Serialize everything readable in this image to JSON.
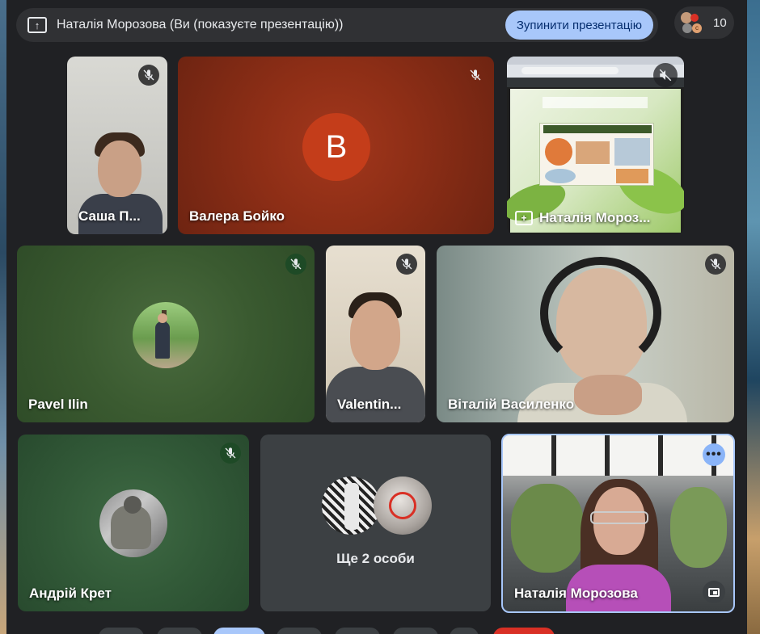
{
  "top_bar": {
    "presenting_text": "Наталія Морозова (Ви (показуєте презентацію))",
    "stop_button_label": "Зупинити презентацію",
    "participant_count": "10"
  },
  "avatar_initial": "B",
  "tiles": [
    {
      "name": "Саша П..."
    },
    {
      "name": "Валера Бойко"
    },
    {
      "name": "Наталія Мороз..."
    },
    {
      "name": "Pavel Ilin"
    },
    {
      "name": "Valentin..."
    },
    {
      "name": "Віталій Василенко"
    },
    {
      "name": "Андрій Крет"
    },
    {
      "more_label": "Ще 2 особи"
    },
    {
      "name": "Наталія Морозова"
    }
  ],
  "colors": {
    "accent": "#a8c7fa",
    "background": "#202124",
    "avatar_red": "#c43d1a"
  },
  "icons": [
    "present-screen-icon",
    "mic-off-icon",
    "volume-off-icon",
    "more-options-icon",
    "pip-icon"
  ]
}
